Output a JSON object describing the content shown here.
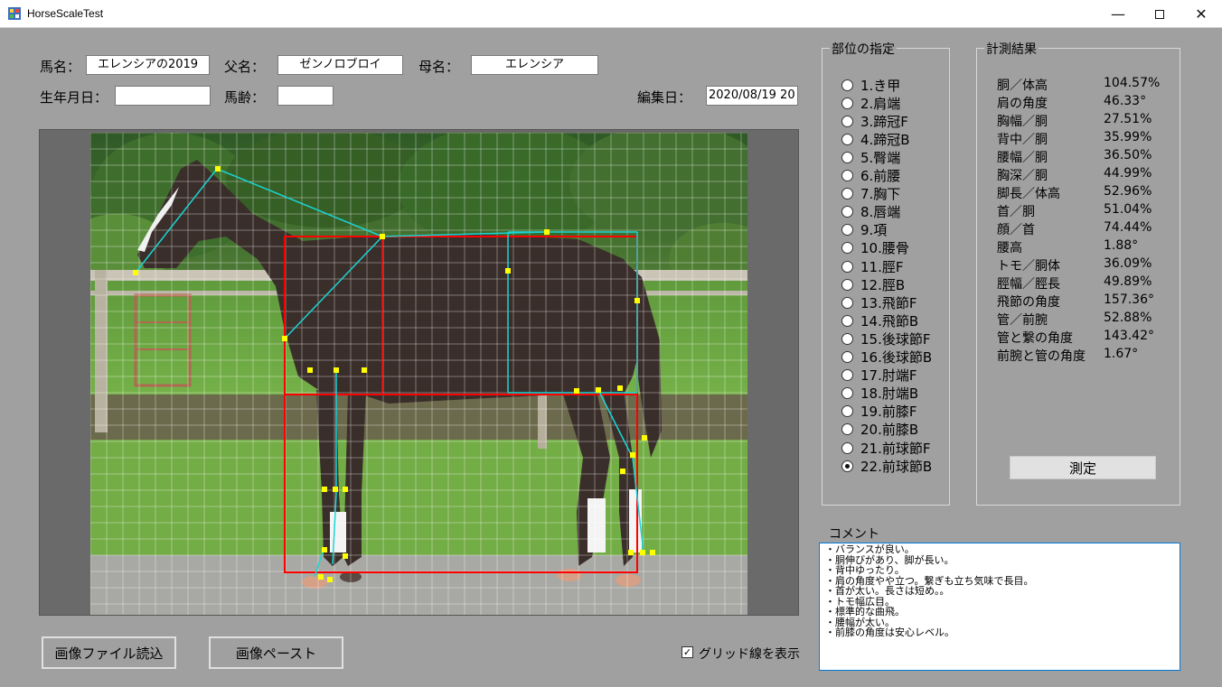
{
  "window": {
    "title": "HorseScaleTest",
    "minimize_icon": "minimize-icon",
    "maximize_icon": "maximize-icon",
    "close_icon": "close-icon"
  },
  "form": {
    "horse_name_label": "馬名：",
    "horse_name_value": "エレンシアの2019",
    "sire_label": "父名：",
    "sire_value": "ゼンノロブロイ",
    "dam_label": "母名：",
    "dam_value": "エレンシア",
    "birthdate_label": "生年月日：",
    "birthdate_value": "",
    "age_label": "馬齢：",
    "age_value": "",
    "edit_date_label": "編集日：",
    "edit_date_value": "2020/08/19 20"
  },
  "parts": {
    "title": "部位の指定",
    "selected_index": 21,
    "items": [
      "1.き甲",
      "2.肩端",
      "3.蹄冠F",
      "4.蹄冠B",
      "5.臀端",
      "6.前腰",
      "7.胸下",
      "8.唇端",
      "9.項",
      "10.腰骨",
      "11.脛F",
      "12.脛B",
      "13.飛節F",
      "14.飛節B",
      "15.後球節F",
      "16.後球節B",
      "17.肘端F",
      "18.肘端B",
      "19.前膝F",
      "20.前膝B",
      "21.前球節F",
      "22.前球節B"
    ]
  },
  "results": {
    "title": "計測結果",
    "rows": [
      {
        "label": "胴／体高",
        "value": "104.57%"
      },
      {
        "label": "肩の角度",
        "value": "46.33°"
      },
      {
        "label": "胸幅／胴",
        "value": "27.51%"
      },
      {
        "label": "背中／胴",
        "value": "35.99%"
      },
      {
        "label": "腰幅／胴",
        "value": "36.50%"
      },
      {
        "label": "胸深／胴",
        "value": "44.99%"
      },
      {
        "label": "脚長／体高",
        "value": "52.96%"
      },
      {
        "label": "首／胴",
        "value": "51.04%"
      },
      {
        "label": "顔／首",
        "value": "74.44%"
      },
      {
        "label": "腰高",
        "value": "1.88°"
      },
      {
        "label": "トモ／胴体",
        "value": "36.09%"
      },
      {
        "label": "脛幅／脛長",
        "value": "49.89%"
      },
      {
        "label": "飛節の角度",
        "value": "157.36°"
      },
      {
        "label": "管／前腕",
        "value": "52.88%"
      },
      {
        "label": "管と繋の角度",
        "value": "143.42°"
      },
      {
        "label": "前腕と管の角度",
        "value": "1.67°"
      }
    ],
    "measure_button": "測定"
  },
  "comment": {
    "label": "コメント",
    "lines": [
      "・バランスが良い。",
      "・胴伸びがあり、脚が長い。",
      "・背中ゆったり。",
      "・肩の角度やや立つ。繋ぎも立ち気味で長目。",
      "・首が太い。長さは短め。。",
      "・トモ幅広目。",
      "・標準的な曲飛。",
      "・腰幅が太い。",
      "・前膝の角度は安心レベル。"
    ]
  },
  "buttons": {
    "load_image": "画像ファイル読込",
    "paste_image": "画像ペースト"
  },
  "grid": {
    "show_label": "グリッド線を表示",
    "checked": true
  },
  "colors": {
    "background": "#a0a0a0",
    "measure_box": "#ff0000",
    "measure_line": "#19d6d6",
    "marker": "#ffff00"
  }
}
